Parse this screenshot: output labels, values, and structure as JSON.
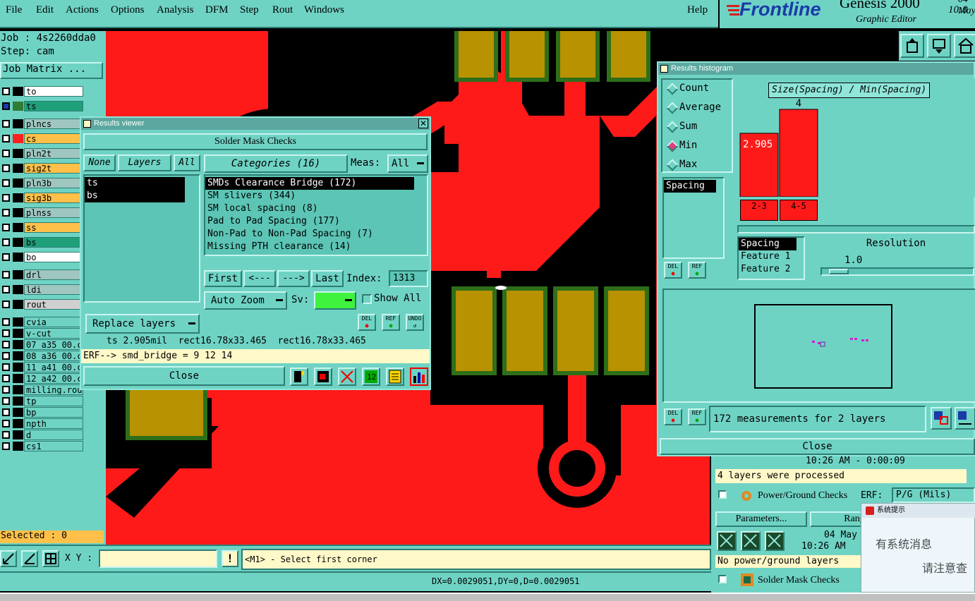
{
  "menu": {
    "items": [
      "File",
      "Edit",
      "Actions",
      "Options",
      "Analysis",
      "DFM",
      "Step",
      "Rout",
      "Windows"
    ],
    "help": "Help"
  },
  "brand": {
    "logo": "Frontline",
    "product": "Genesis 2000",
    "subtitle": "Graphic Editor",
    "date_fragment": "04 May",
    "time_fragment": "10:0"
  },
  "job": {
    "job_label": "Job : 4s2260dda0",
    "step_label": "Step: cam",
    "matrix_button": "Job Matrix ..."
  },
  "layers": [
    {
      "name": "to",
      "swatch": "#000000",
      "bg": "#ffffff",
      "active": false
    },
    {
      "name": "ts",
      "swatch": "#2e7d32",
      "bg": "#1fa07a",
      "active": true
    },
    {
      "name": "plncs",
      "swatch": "#000000",
      "bg": "#9fc6c0",
      "active": false
    },
    {
      "name": "cs",
      "swatch": "#ff2020",
      "bg": "#ffc04a",
      "active": false
    },
    {
      "name": "pln2t",
      "swatch": "#000000",
      "bg": "#9fc6c0",
      "active": false
    },
    {
      "name": "sig2t",
      "swatch": "#000000",
      "bg": "#ffc04a",
      "active": false
    },
    {
      "name": "pln3b",
      "swatch": "#000000",
      "bg": "#9fc6c0",
      "active": false
    },
    {
      "name": "sig3b",
      "swatch": "#000000",
      "bg": "#ffc04a",
      "active": false
    },
    {
      "name": "plnss",
      "swatch": "#000000",
      "bg": "#9fc6c0",
      "active": false
    },
    {
      "name": "ss",
      "swatch": "#000000",
      "bg": "#ffc04a",
      "active": false
    },
    {
      "name": "bs",
      "swatch": "#000000",
      "bg": "#1fa07a",
      "active": false
    },
    {
      "name": "bo",
      "swatch": "#000000",
      "bg": "#ffffff",
      "active": false
    },
    {
      "name": "drl",
      "swatch": "#000000",
      "bg": "#9fc6c0",
      "active": false
    },
    {
      "name": "ldi",
      "swatch": "#000000",
      "bg": "#9fc6c0",
      "active": false
    },
    {
      "name": "rout",
      "swatch": "#000000",
      "bg": "#d0d0d0",
      "active": false
    },
    {
      "name": "cvia",
      "swatch": "#000000",
      "bg": "#6fd3c4",
      "active": false
    },
    {
      "name": "v-cut",
      "swatch": "#000000",
      "bg": "#6fd3c4",
      "active": false
    },
    {
      "name": "07_a35_00.c",
      "swatch": "#000000",
      "bg": "#6fd3c4",
      "active": false
    },
    {
      "name": "08_a36_00.c",
      "swatch": "#000000",
      "bg": "#6fd3c4",
      "active": false
    },
    {
      "name": "11_a41_00.c",
      "swatch": "#000000",
      "bg": "#6fd3c4",
      "active": false
    },
    {
      "name": "12_a42_00.c",
      "swatch": "#000000",
      "bg": "#6fd3c4",
      "active": false
    },
    {
      "name": "milling.rou",
      "swatch": "#000000",
      "bg": "#6fd3c4",
      "active": false
    },
    {
      "name": "tp",
      "swatch": "#000000",
      "bg": "#6fd3c4",
      "active": false
    },
    {
      "name": "bp",
      "swatch": "#000000",
      "bg": "#6fd3c4",
      "active": false
    },
    {
      "name": "npth",
      "swatch": "#000000",
      "bg": "#6fd3c4",
      "active": false
    },
    {
      "name": "d",
      "swatch": "#000000",
      "bg": "#6fd3c4",
      "active": false
    },
    {
      "name": "cs1",
      "swatch": "#000000",
      "bg": "#6fd3c4",
      "active": false
    }
  ],
  "selected": "Selected : 0",
  "bottom": {
    "xy_label": "X Y :",
    "xy_value": "",
    "prompt": "<M1> - Select first corner",
    "measure": "DX=0.0029051,DY=0,D=0.0029051"
  },
  "results_viewer": {
    "title": "Results viewer",
    "header": "Solder Mask Checks",
    "none_btn": "None",
    "layers_btn": "Layers",
    "all_btn": "All",
    "layers": [
      "ts",
      "bs"
    ],
    "categories_btn": "Categories (16)",
    "meas_label": "Meas:",
    "meas_value": "All",
    "categories": [
      "SMDs Clearance Bridge (172)",
      "SM slivers (344)",
      "SM local spacing (8)",
      "Pad to Pad Spacing (177)",
      "Non-Pad to Non-Pad Spacing (7)",
      "Missing PTH clearance (14)"
    ],
    "first_btn": "First",
    "prev_btn": "<---",
    "next_btn": "--->",
    "last_btn": "Last",
    "index_label": "Index:",
    "index_value": "1313",
    "auto_zoom": "Auto Zoom",
    "sv_label": "Sv:",
    "show_all": "Show All",
    "replace_layers": "Replace layers",
    "del": "DEL",
    "ref": "REF",
    "undo": "UNDO",
    "info": "ts 2.905mil  rect16.78x33.465  rect16.78x33.465",
    "erf": "ERF--> smd_bridge = 9 12 14",
    "close": "Close"
  },
  "histogram": {
    "title": "Results histogram",
    "modes": [
      "Count",
      "Average",
      "Sum",
      "Min",
      "Max"
    ],
    "selected_mode": "Min",
    "chart_title": "Size(Spacing) / Min(Spacing)",
    "field_list": [
      "Spacing"
    ],
    "sort_list": [
      "Spacing",
      "Feature 1",
      "Feature 2"
    ],
    "resolution_label": "Resolution",
    "resolution_value": "1.0",
    "summary": "172 measurements for 2 layers",
    "close": "Close",
    "del": "DEL",
    "ref": "REF"
  },
  "chart_data": {
    "type": "bar",
    "title": "Size(Spacing) / Min(Spacing)",
    "categories": [
      "2-3",
      "4-5"
    ],
    "values": [
      2.905,
      4
    ],
    "data_labels": [
      "2.905",
      "4"
    ],
    "colors": [
      "#ff1a1a",
      "#ff1a1a"
    ]
  },
  "background_window": {
    "time": "10:26 AM - 0:00:09",
    "processed": "4 layers were processed",
    "pg_checks": "Power/Ground Checks",
    "erf_label": "ERF:",
    "erf_value": "P/G (Mils)",
    "parameters_btn": "Parameters...",
    "range_btn": "Range",
    "date": "04 May",
    "time2": "10:26 AM",
    "no_pg": "No power/ground layers",
    "sm_checks": "Solder Mask Checks"
  },
  "popup": {
    "title": "系统提示",
    "line1": "有系统消息",
    "line2": "请注意查"
  }
}
